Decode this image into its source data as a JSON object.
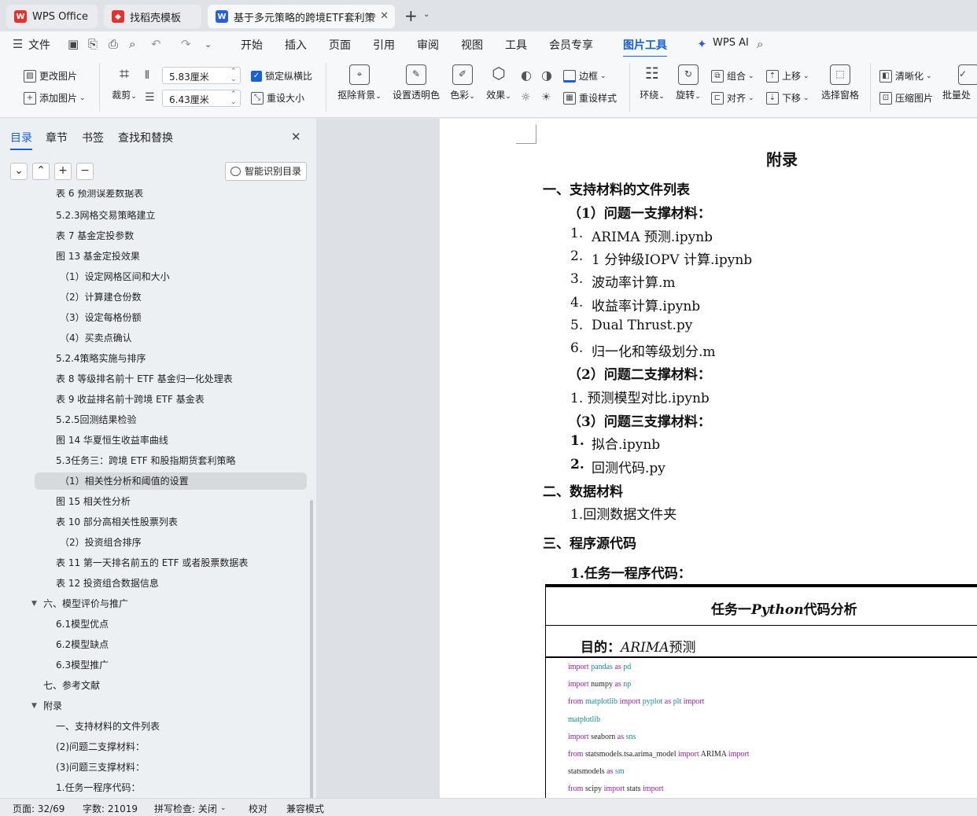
{
  "tabs": [
    {
      "label": "WPS Office",
      "icon": "wps-logo-icon",
      "color": "#e5322d"
    },
    {
      "label": "找稻壳模板",
      "icon": "docer-icon",
      "color": "#e5322d"
    },
    {
      "label": "基于多元策略的跨境ETF套利策",
      "icon": "word-doc-icon",
      "color": "#2b5fd9"
    }
  ],
  "menu": {
    "file": "文件",
    "items": [
      "开始",
      "插入",
      "页面",
      "引用",
      "审阅",
      "视图",
      "工具",
      "会员专享",
      "图片工具"
    ],
    "ai": "WPS AI"
  },
  "ribbon": {
    "change_image": "更改图片",
    "add_image": "添加图片",
    "crop": "裁剪",
    "width": "5.83厘米",
    "height": "6.43厘米",
    "lock_ratio": "锁定纵横比",
    "reset_size": "重设大小",
    "remove_bg": "抠除背景",
    "set_transparent": "设置透明色",
    "color": "色彩",
    "effect": "效果",
    "border": "边框",
    "reset_style": "重设样式",
    "wrap": "环绕",
    "rotate": "旋转",
    "group": "组合",
    "align": "对齐",
    "bring_up": "上移",
    "send_down": "下移",
    "selection_pane": "选择窗格",
    "sharpen": "清晰化",
    "compress": "压缩图片",
    "batch": "批量处"
  },
  "nav": {
    "tabs": [
      "目录",
      "章节",
      "书签",
      "查找和替换"
    ],
    "smart": "智能识别目录",
    "items": [
      "表 6 预测误差数据表",
      "5.2.3网格交易策略建立",
      "表 7 基金定投参数",
      "图 13 基金定投效果",
      "（1）设定网格区间和大小",
      "（2）计算建仓份数",
      "（3）设定每格份额",
      "（4）买卖点确认",
      "5.2.4策略实施与排序",
      "表 8 等级排名前十 ETF 基金归一化处理表",
      "表 9 收益排名前十跨境 ETF 基金表",
      "5.2.5回测结果检验",
      "图 14 华夏恒生收益率曲线",
      "5.3任务三：跨境 ETF 和股指期货套利策略",
      "（1）相关性分析和阈值的设置",
      "图 15 相关性分析",
      "表 10 部分高相关性股票列表",
      "（2）投资组合排序",
      "表 11 第一天排名前五的 ETF 或者股票数据表",
      "表 12 投资组合数据信息",
      "六、模型评价与推广",
      "6.1模型优点",
      "6.2模型缺点",
      "6.3模型推广",
      "七、参考文献",
      "附录",
      "一、支持材料的文件列表",
      "(2)问题二支撑材料：",
      "(3)问题三支撑材料：",
      "1.任务一程序代码："
    ]
  },
  "doc": {
    "title": "附录",
    "s1": "一、支持材料的文件列表",
    "q1": "（1）问题一支撑材料：",
    "q1_items": [
      [
        "1.",
        "ARIMA 预测.ipynb"
      ],
      [
        "2.",
        "1 分钟级IOPV 计算.ipynb"
      ],
      [
        "3.",
        "波动率计算.m"
      ],
      [
        "4.",
        "收益率计算.ipynb"
      ],
      [
        "5.",
        "Dual Thrust.py"
      ],
      [
        "6.",
        "归一化和等级划分.m"
      ]
    ],
    "q2": "（2）问题二支撑材料：",
    "q2_item": "1. 预测模型对比.ipynb",
    "q3": "（3）问题三支撑材料：",
    "q3_items": [
      [
        "1.",
        "拟合.ipynb"
      ],
      [
        "2.",
        "回测代码.py"
      ]
    ],
    "s2": "二、数据材料",
    "s2_item": "1.回测数据文件夹",
    "s3": "三、程序源代码",
    "task1": "1.任务一程序代码：",
    "table_title_a": "任务一",
    "table_title_b": "Python",
    "table_title_c": "代码分析",
    "purpose_label": "目的：",
    "purpose_a": "ARIMA",
    "purpose_b": "预测"
  },
  "code_lines": [
    [
      [
        "kw",
        "import "
      ],
      [
        "md",
        "pandas"
      ],
      [
        "kw",
        " as "
      ],
      [
        "md",
        "pd"
      ]
    ],
    [
      [
        "kw",
        "import "
      ],
      [
        "",
        "numpy"
      ],
      [
        "kw",
        " as "
      ],
      [
        "md",
        "np"
      ]
    ],
    [
      [
        "kw",
        "from "
      ],
      [
        "md",
        "matplotlib"
      ],
      [
        "kw",
        " import "
      ],
      [
        "md",
        "pyplot"
      ],
      [
        "kw",
        " as "
      ],
      [
        "md",
        "plt"
      ],
      [
        "kw",
        " import"
      ]
    ],
    [
      [
        "md",
        "matplotlib"
      ]
    ],
    [
      [
        "kw",
        "import "
      ],
      [
        "",
        "seaborn"
      ],
      [
        "kw",
        " as "
      ],
      [
        "md",
        "sns"
      ]
    ],
    [
      [
        "kw",
        "from "
      ],
      [
        "",
        "statsmodels.tsa.arima_model"
      ],
      [
        "kw",
        " import "
      ],
      [
        "",
        "ARIMA"
      ],
      [
        "kw",
        " import"
      ]
    ],
    [
      [
        "",
        "statsmodels"
      ],
      [
        "kw",
        " as "
      ],
      [
        "md",
        "sm"
      ]
    ],
    [
      [
        "kw",
        "from "
      ],
      [
        "",
        "scipy"
      ],
      [
        "kw",
        " import "
      ],
      [
        "",
        "stats"
      ],
      [
        "kw",
        " import"
      ]
    ]
  ],
  "status": {
    "page": "页面: 32/69",
    "words": "字数: 21019",
    "spell": "拼写检查: 关闭",
    "proof": "校对",
    "compat": "兼容模式"
  }
}
